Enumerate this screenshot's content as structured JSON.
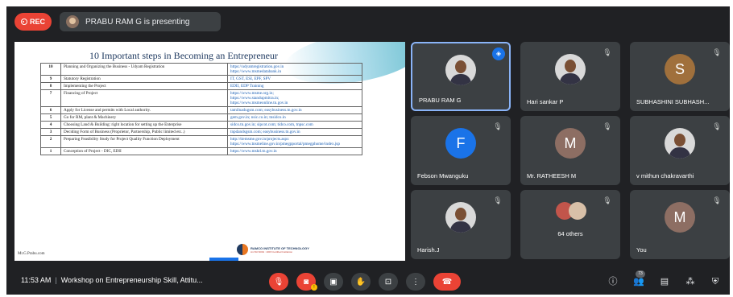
{
  "top": {
    "rec_label": "REC",
    "presenting_text": "PRABU RAM G is presenting"
  },
  "slide": {
    "title": "10 Important steps in Becoming an Entrepreneur",
    "rows": [
      {
        "num": "10",
        "step": "Planning and Organizing the Business - Udyam Registration",
        "links": "https://udyamregistration.gov.in\nhttps://www.msmedatabank.in"
      },
      {
        "num": "9",
        "step": "Statutory Registration",
        "links": "IT, GST, ESI, EPF, SPV"
      },
      {
        "num": "8",
        "step": "Implementing the Project",
        "links": "EDII, EDP Training"
      },
      {
        "num": "7",
        "step": "Financing of Project",
        "links": "https://www.msme.org.in;\nhttps://www.standupmitra.in;\nhttps://www.msmeonline.tn.gov.in"
      },
      {
        "num": "6",
        "step": "Apply for License and permits with Local authority.",
        "links": "tamilnadugsm.com; easybusiness.tn.gov.in"
      },
      {
        "num": "5",
        "step": "Go for RM, plant & Machinery",
        "links": "gem.gov.in; nsic.co.in; tnsidco.in"
      },
      {
        "num": "4",
        "step": "Choosing Land & Building: right location for setting up the Enterprise",
        "links": "sidco.tn.gov.in; sipcot.com; tidco.com, tnpsc.com"
      },
      {
        "num": "3",
        "step": "Deciding Form of Business (Proprietor, Partnership, Public limited etc..)",
        "links": "tnpdandsgsm.com; easybusiness.tn.gov.in"
      },
      {
        "num": "2",
        "step": "Preparing Feasibility Study for Project Quality Function Deployment",
        "links": "http://tiemsme.gov.in/projects.aspx\nhttps://www.tnsmeline.gov.in/pmegpportal/pmegphome/index.jsp"
      },
      {
        "num": "1",
        "step": "Conception of Project - DIC, EDII",
        "links": "https://www.msktl.tn.gov.in"
      }
    ],
    "author": "Mr.G.Prabu.com",
    "logo_name": "RAMCO INSTITUTE OF TECHNOLOGY",
    "logo_sub": "An ISO 9001 : 2015 Certified Institution"
  },
  "participants": [
    {
      "name": "PRABU RAM G",
      "type": "photo",
      "active": true
    },
    {
      "name": "Hari sankar P",
      "type": "photo"
    },
    {
      "name": "SUBHASHINI SUBHASH...",
      "type": "initial",
      "initial": "S",
      "color": "#a0703c"
    },
    {
      "name": "Febson Mwanguku",
      "type": "initial",
      "initial": "F",
      "color": "#1a73e8"
    },
    {
      "name": "Mr. RATHEESH M",
      "type": "initial",
      "initial": "M",
      "color": "#8d6e63"
    },
    {
      "name": "v mithun chakravarthi",
      "type": "photo"
    },
    {
      "name": "Harish.J",
      "type": "photo"
    },
    {
      "name": "64 others",
      "type": "others"
    },
    {
      "name": "You",
      "type": "initial",
      "initial": "M",
      "color": "#8d6e63"
    }
  ],
  "bottom": {
    "time": "11:53 AM",
    "meeting_title": "Workshop on Entrepreneurship Skill, Attitu...",
    "participants_count": "73",
    "colors": {
      "red": "#ea4335",
      "dark": "#3c4043",
      "accent": "#1a73e8"
    }
  }
}
